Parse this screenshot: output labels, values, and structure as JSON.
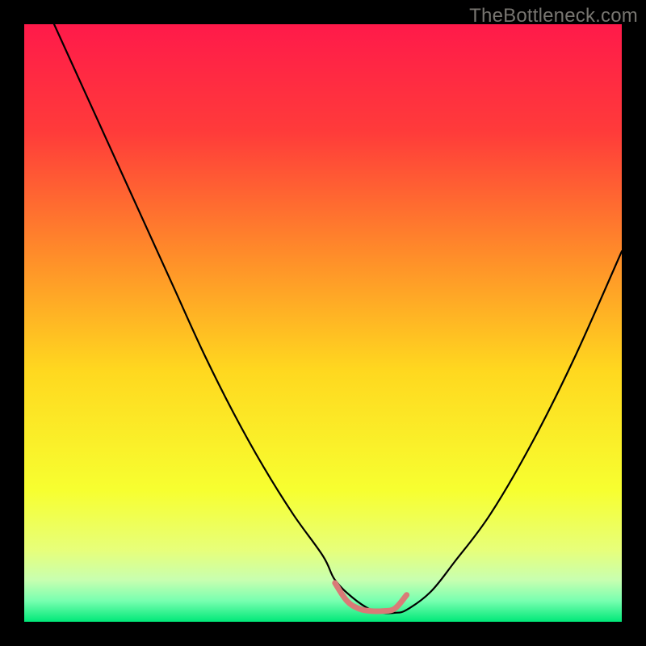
{
  "watermark": "TheBottleneck.com",
  "chart_data": {
    "type": "line",
    "title": "",
    "xlabel": "",
    "ylabel": "",
    "xlim": [
      0,
      100
    ],
    "ylim": [
      0,
      100
    ],
    "background_gradient_stops": [
      {
        "offset": 0,
        "color": "#ff1a4a"
      },
      {
        "offset": 0.18,
        "color": "#ff3b3a"
      },
      {
        "offset": 0.38,
        "color": "#ff8a2a"
      },
      {
        "offset": 0.58,
        "color": "#ffd81f"
      },
      {
        "offset": 0.78,
        "color": "#f7ff30"
      },
      {
        "offset": 0.88,
        "color": "#e7ff7a"
      },
      {
        "offset": 0.93,
        "color": "#c8ffb0"
      },
      {
        "offset": 0.965,
        "color": "#78ffb0"
      },
      {
        "offset": 1.0,
        "color": "#00e878"
      }
    ],
    "series": [
      {
        "name": "bottleneck-curve",
        "stroke": "#000000",
        "stroke_width": 2.2,
        "x": [
          5,
          10,
          15,
          20,
          25,
          30,
          35,
          40,
          45,
          50,
          52,
          55,
          58,
          60,
          62,
          64,
          68,
          72,
          78,
          85,
          92,
          100
        ],
        "values": [
          100,
          89,
          78,
          67,
          56,
          45,
          35,
          26,
          18,
          11,
          7,
          4,
          2,
          1.5,
          1.5,
          2,
          5,
          10,
          18,
          30,
          44,
          62
        ]
      },
      {
        "name": "optimal-zone",
        "stroke": "#d97a77",
        "stroke_width": 7,
        "x": [
          52,
          54,
          56,
          58,
          60,
          62,
          64
        ],
        "values": [
          6.5,
          3.5,
          2.2,
          1.8,
          1.8,
          2.2,
          4.5
        ]
      }
    ]
  }
}
